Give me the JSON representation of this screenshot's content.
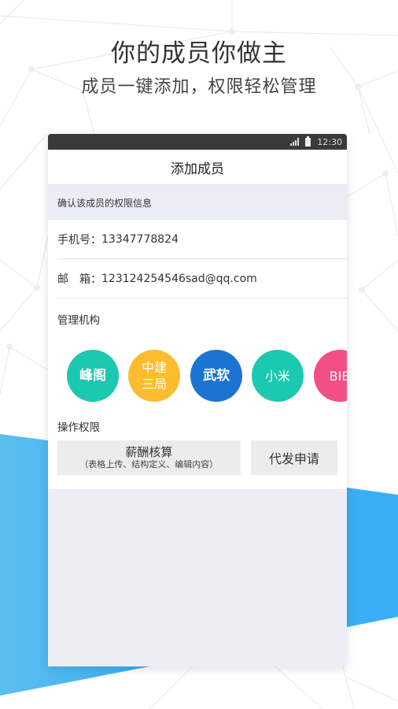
{
  "promo": {
    "headline": "你的成员你做主",
    "subline": "成员一键添加，权限轻松管理"
  },
  "colors": {
    "accent_blue": "#3daff3",
    "status_bar": "#3a3a3a",
    "page_bg": "#eceef4"
  },
  "status_bar": {
    "time": "12:30",
    "signal_icon": "signal-icon",
    "battery_icon": "battery-icon"
  },
  "nav": {
    "title": "添加成员"
  },
  "info_band": {
    "text": "确认该成员的权限信息"
  },
  "fields": [
    {
      "label": "手机号：",
      "value": "13347778824"
    },
    {
      "label": "邮　箱：",
      "value": "123124254546sad@qq.com"
    }
  ],
  "orgs": {
    "label": "管理机构",
    "items": [
      {
        "name": "峰阁",
        "line1": "峰阁",
        "line2": "",
        "color": "#1cc8b0"
      },
      {
        "name": "中建三局",
        "line1": "中建",
        "line2": "三局",
        "color": "#fbbc2e"
      },
      {
        "name": "武软",
        "line1": "武软",
        "line2": "",
        "color": "#1b74d2"
      },
      {
        "name": "小米",
        "line1": "小米",
        "line2": "",
        "color": "#1cc8b0"
      },
      {
        "name": "BIB",
        "line1": "BIB",
        "line2": "",
        "color": "#f24f86"
      }
    ]
  },
  "permissions": {
    "label": "操作权限",
    "items": [
      {
        "title": "薪酬核算",
        "subtitle": "（表格上传、结构定义、编辑内容）"
      },
      {
        "title": "代发申请",
        "subtitle": ""
      }
    ]
  }
}
